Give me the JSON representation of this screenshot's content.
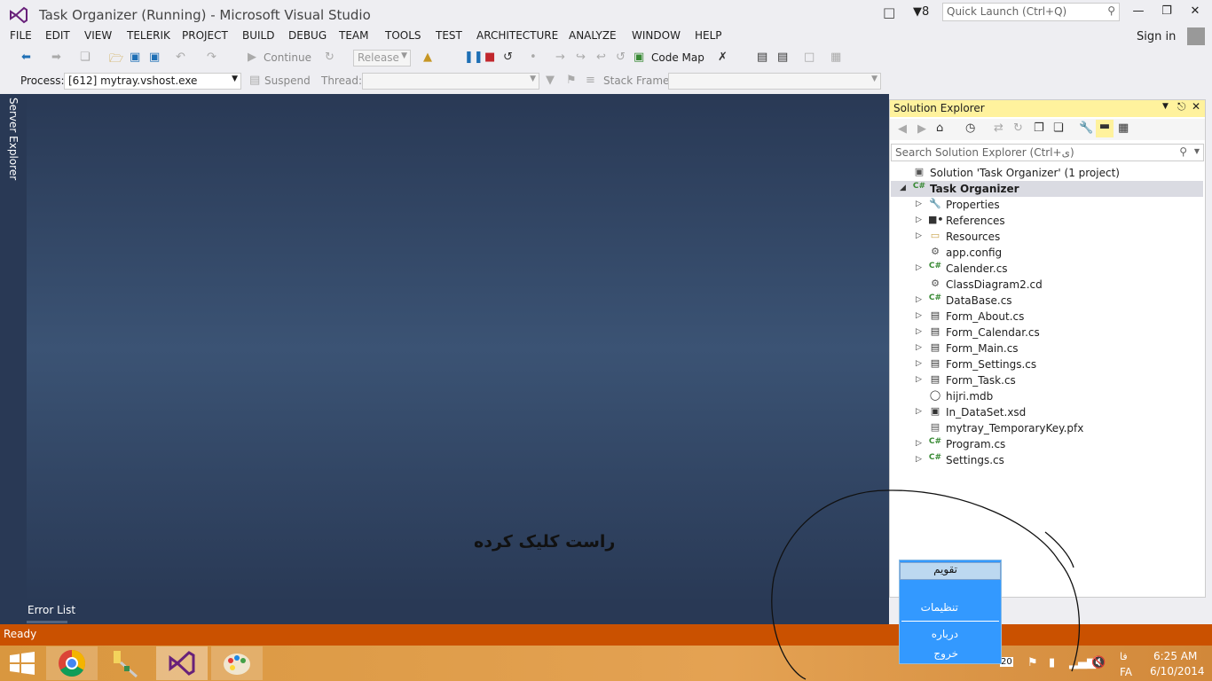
{
  "window": {
    "title": "Task Organizer (Running) - Microsoft Visual Studio",
    "notifications_count": "8",
    "quick_launch_placeholder": "Quick Launch (Ctrl+Q)",
    "sign_in": "Sign in"
  },
  "menu": [
    "FILE",
    "EDIT",
    "VIEW",
    "TELERIK",
    "PROJECT",
    "BUILD",
    "DEBUG",
    "TEAM",
    "TOOLS",
    "TEST",
    "ARCHITECTURE",
    "ANALYZE",
    "WINDOW",
    "HELP"
  ],
  "toolbar": {
    "continue_label": "Continue",
    "config_value": "Release",
    "code_map_label": "Code Map",
    "process_label": "Process:",
    "process_value": "[612] mytray.vshost.exe",
    "suspend_label": "Suspend",
    "thread_label": "Thread:",
    "stack_frame_label": "Stack Frame:"
  },
  "side_tab": "Server Explorer",
  "bottom_tab": "Error List",
  "annotation_text": "راست کلیک کرده",
  "status_text": "Ready",
  "solution_explorer": {
    "title": "Solution Explorer",
    "search_placeholder": "Search Solution Explorer (Ctrl+ی)",
    "items": [
      {
        "label": "Solution 'Task Organizer' (1 project)",
        "icon": "solution-icon",
        "indent": 0,
        "expander": "",
        "selected": false
      },
      {
        "label": "Task Organizer",
        "icon": "csharp-project-icon",
        "indent": 0,
        "expander": "expanded",
        "selected": true
      },
      {
        "label": "Properties",
        "icon": "wrench-icon",
        "indent": 1,
        "expander": "collapsed",
        "selected": false
      },
      {
        "label": "References",
        "icon": "references-icon",
        "indent": 1,
        "expander": "collapsed",
        "selected": false
      },
      {
        "label": "Resources",
        "icon": "folder-icon",
        "indent": 1,
        "expander": "collapsed",
        "selected": false
      },
      {
        "label": "app.config",
        "icon": "config-file-icon",
        "indent": 1,
        "expander": "",
        "selected": false
      },
      {
        "label": "Calender.cs",
        "icon": "csharp-file-icon",
        "indent": 1,
        "expander": "collapsed",
        "selected": false
      },
      {
        "label": "ClassDiagram2.cd",
        "icon": "class-diagram-icon",
        "indent": 1,
        "expander": "",
        "selected": false
      },
      {
        "label": "DataBase.cs",
        "icon": "csharp-file-icon",
        "indent": 1,
        "expander": "collapsed",
        "selected": false
      },
      {
        "label": "Form_About.cs",
        "icon": "form-icon",
        "indent": 1,
        "expander": "collapsed",
        "selected": false
      },
      {
        "label": "Form_Calendar.cs",
        "icon": "form-icon",
        "indent": 1,
        "expander": "collapsed",
        "selected": false
      },
      {
        "label": "Form_Main.cs",
        "icon": "form-icon",
        "indent": 1,
        "expander": "collapsed",
        "selected": false
      },
      {
        "label": "Form_Settings.cs",
        "icon": "form-icon",
        "indent": 1,
        "expander": "collapsed",
        "selected": false
      },
      {
        "label": "Form_Task.cs",
        "icon": "form-icon",
        "indent": 1,
        "expander": "collapsed",
        "selected": false
      },
      {
        "label": "hijri.mdb",
        "icon": "database-icon",
        "indent": 1,
        "expander": "",
        "selected": false
      },
      {
        "label": "In_DataSet.xsd",
        "icon": "dataset-icon",
        "indent": 1,
        "expander": "collapsed",
        "selected": false
      },
      {
        "label": "mytray_TemporaryKey.pfx",
        "icon": "certificate-icon",
        "indent": 1,
        "expander": "",
        "selected": false
      },
      {
        "label": "Program.cs",
        "icon": "csharp-file-icon",
        "indent": 1,
        "expander": "collapsed",
        "selected": false
      },
      {
        "label": "Settings.cs",
        "icon": "csharp-file-icon",
        "indent": 1,
        "expander": "collapsed",
        "selected": false
      }
    ]
  },
  "context_menu": [
    "تقویم",
    "تنظیمات",
    "درباره",
    "خروج"
  ],
  "tray": {
    "time": "6:25 AM",
    "date": "6/10/2014",
    "lang_fa": "فا",
    "lang": "FA",
    "badge": "20"
  },
  "colors": {
    "status_bar": "#ca5100",
    "doc_background": "#293955",
    "se_header": "#fff29d",
    "context_menu": "#3399ff"
  }
}
